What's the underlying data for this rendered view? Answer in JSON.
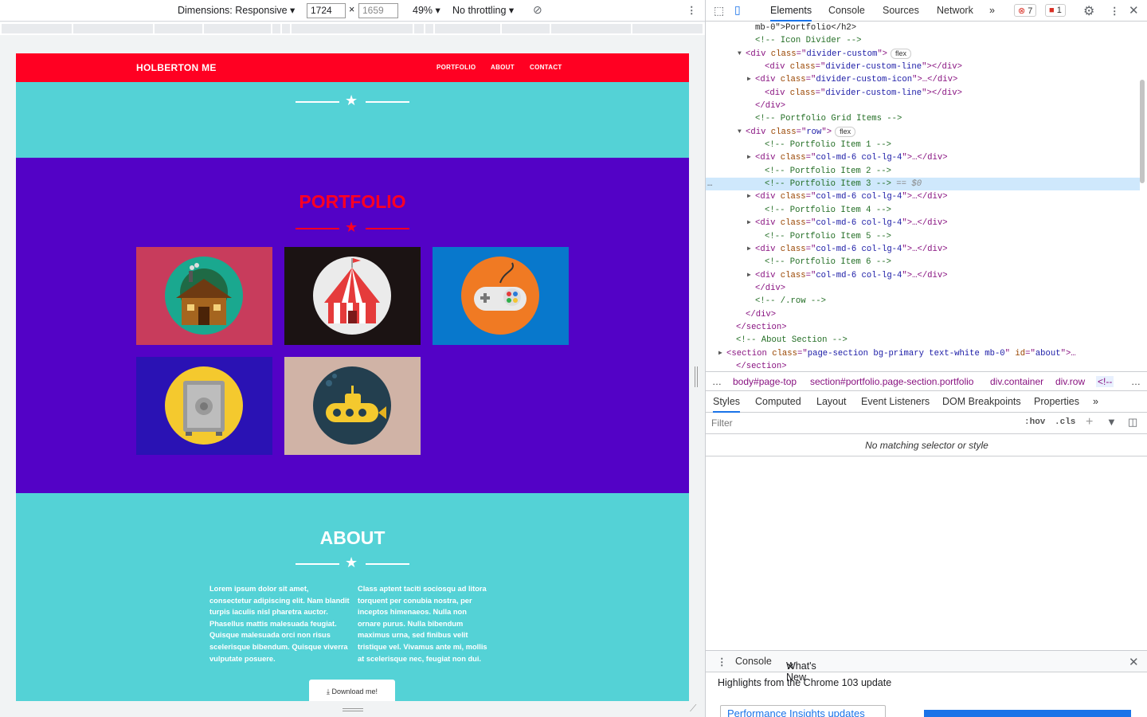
{
  "devbar": {
    "dimensions_label": "Dimensions: Responsive",
    "width": "1724",
    "x": "×",
    "height_placeholder": "1659",
    "zoom": "49%",
    "throttle": "No throttling"
  },
  "site": {
    "brand": "HOLBERTON ME",
    "nav": [
      "PORTFOLIO",
      "ABOUT",
      "CONTACT"
    ],
    "portfolio_title": "PORTFOLIO",
    "about_title": "ABOUT",
    "about_col1": "Lorem ipsum dolor sit amet, consectetur adipiscing elit. Nam blandit turpis iaculis nisl pharetra auctor. Phasellus mattis malesuada feugiat. Quisque malesuada orci non risus scelerisque bibendum. Quisque viverra vulputate posuere.",
    "about_col2": "Class aptent taciti sociosqu ad litora torquent per conubia nostra, per inceptos himenaeos. Nulla non ornare purus. Nulla bibendum maximus urna, sed finibus velit tristique vel. Vivamus ante mi, mollis at scelerisque nec, feugiat non dui.",
    "download": "Download me!",
    "colors": {
      "nav": "#ff0022",
      "teal": "#54d2d6",
      "purple": "#5302c6"
    },
    "tiles": [
      {
        "icon": "cabin-icon",
        "bg": "#c83c5c"
      },
      {
        "icon": "circus-tent-icon",
        "bg": "#1b1313"
      },
      {
        "icon": "game-controller-icon",
        "bg": "#0878cc"
      },
      {
        "icon": "safe-icon",
        "bg": "#2a12b4"
      },
      {
        "icon": "submarine-icon",
        "bg": "#d0b3a6"
      }
    ]
  },
  "devtools": {
    "tabs": [
      "Elements",
      "Console",
      "Sources",
      "Network",
      "»"
    ],
    "errors": "7",
    "warnings": "1",
    "code_lines": [
      {
        "indent": 5,
        "parts": [
          [
            "tx",
            "mb-0\">Portfolio</h2>"
          ]
        ]
      },
      {
        "indent": 5,
        "parts": [
          [
            "cm",
            "<!-- Icon Divider -->"
          ]
        ]
      },
      {
        "indent": 4,
        "arrow": "▼",
        "parts": [
          [
            "tg",
            "<div "
          ],
          [
            "an",
            "class"
          ],
          [
            "tg",
            "=\""
          ],
          [
            "av",
            "divider-custom"
          ],
          [
            "tg",
            "\">"
          ]
        ],
        "pill": "flex"
      },
      {
        "indent": 6,
        "parts": [
          [
            "tg",
            "<div "
          ],
          [
            "an",
            "class"
          ],
          [
            "tg",
            "=\""
          ],
          [
            "av",
            "divider-custom-line"
          ],
          [
            "tg",
            "\"></div>"
          ]
        ]
      },
      {
        "indent": 5,
        "arrow": "▶",
        "parts": [
          [
            "tg",
            "<div "
          ],
          [
            "an",
            "class"
          ],
          [
            "tg",
            "=\""
          ],
          [
            "av",
            "divider-custom-icon"
          ],
          [
            "tg",
            "\">…</div>"
          ]
        ]
      },
      {
        "indent": 6,
        "parts": [
          [
            "tg",
            "<div "
          ],
          [
            "an",
            "class"
          ],
          [
            "tg",
            "=\""
          ],
          [
            "av",
            "divider-custom-line"
          ],
          [
            "tg",
            "\"></div>"
          ]
        ]
      },
      {
        "indent": 5,
        "parts": [
          [
            "tg",
            "</div>"
          ]
        ]
      },
      {
        "indent": 5,
        "parts": [
          [
            "cm",
            "<!-- Portfolio Grid Items -->"
          ]
        ]
      },
      {
        "indent": 4,
        "arrow": "▼",
        "parts": [
          [
            "tg",
            "<div "
          ],
          [
            "an",
            "class"
          ],
          [
            "tg",
            "=\""
          ],
          [
            "av",
            "row"
          ],
          [
            "tg",
            "\">"
          ]
        ],
        "pill": "flex"
      },
      {
        "indent": 6,
        "parts": [
          [
            "cm",
            "<!-- Portfolio Item 1 -->"
          ]
        ]
      },
      {
        "indent": 5,
        "arrow": "▶",
        "parts": [
          [
            "tg",
            "<div "
          ],
          [
            "an",
            "class"
          ],
          [
            "tg",
            "=\""
          ],
          [
            "av",
            "col-md-6 col-lg-4"
          ],
          [
            "tg",
            "\">…</div>"
          ]
        ]
      },
      {
        "indent": 6,
        "parts": [
          [
            "cm",
            "<!-- Portfolio Item 2 -->"
          ]
        ]
      },
      {
        "indent": 6,
        "sel": true,
        "parts": [
          [
            "cm",
            "<!-- Portfolio Item 3 -->"
          ],
          [
            "tx",
            " == $0"
          ]
        ]
      },
      {
        "indent": 5,
        "arrow": "▶",
        "parts": [
          [
            "tg",
            "<div "
          ],
          [
            "an",
            "class"
          ],
          [
            "tg",
            "=\""
          ],
          [
            "av",
            "col-md-6 col-lg-4"
          ],
          [
            "tg",
            "\">…</div>"
          ]
        ]
      },
      {
        "indent": 6,
        "parts": [
          [
            "cm",
            "<!-- Portfolio Item 4 -->"
          ]
        ]
      },
      {
        "indent": 5,
        "arrow": "▶",
        "parts": [
          [
            "tg",
            "<div "
          ],
          [
            "an",
            "class"
          ],
          [
            "tg",
            "=\""
          ],
          [
            "av",
            "col-md-6 col-lg-4"
          ],
          [
            "tg",
            "\">…</div>"
          ]
        ]
      },
      {
        "indent": 6,
        "parts": [
          [
            "cm",
            "<!-- Portfolio Item 5 -->"
          ]
        ]
      },
      {
        "indent": 5,
        "arrow": "▶",
        "parts": [
          [
            "tg",
            "<div "
          ],
          [
            "an",
            "class"
          ],
          [
            "tg",
            "=\""
          ],
          [
            "av",
            "col-md-6 col-lg-4"
          ],
          [
            "tg",
            "\">…</div>"
          ]
        ]
      },
      {
        "indent": 6,
        "parts": [
          [
            "cm",
            "<!-- Portfolio Item 6 -->"
          ]
        ]
      },
      {
        "indent": 5,
        "arrow": "▶",
        "parts": [
          [
            "tg",
            "<div "
          ],
          [
            "an",
            "class"
          ],
          [
            "tg",
            "=\""
          ],
          [
            "av",
            "col-md-6 col-lg-4"
          ],
          [
            "tg",
            "\">…</div>"
          ]
        ]
      },
      {
        "indent": 5,
        "parts": [
          [
            "tg",
            "</div>"
          ]
        ]
      },
      {
        "indent": 5,
        "parts": [
          [
            "cm",
            "<!-- /.row -->"
          ]
        ]
      },
      {
        "indent": 4,
        "parts": [
          [
            "tg",
            "</div>"
          ]
        ]
      },
      {
        "indent": 3,
        "parts": [
          [
            "tg",
            "</section>"
          ]
        ]
      },
      {
        "indent": 3,
        "parts": [
          [
            "cm",
            "<!-- About Section -->"
          ]
        ]
      },
      {
        "indent": 2,
        "arrow": "▶",
        "parts": [
          [
            "tg",
            "<section "
          ],
          [
            "an",
            "class"
          ],
          [
            "tg",
            "=\""
          ],
          [
            "av",
            "page-section bg-primary text-white mb-0"
          ],
          [
            "tg",
            "\" "
          ],
          [
            "an",
            "id"
          ],
          [
            "tg",
            "=\""
          ],
          [
            "av",
            "about"
          ],
          [
            "tg",
            "\">…"
          ]
        ]
      },
      {
        "indent": 3,
        "parts": [
          [
            "tg",
            "</section>"
          ]
        ]
      }
    ],
    "breadcrumbs": [
      "…",
      "body#page-top",
      "section#portfolio.page-section.portfolio",
      "div.container",
      "div.row",
      "<!--",
      "…"
    ],
    "style_tabs": [
      "Styles",
      "Computed",
      "Layout",
      "Event Listeners",
      "DOM Breakpoints",
      "Properties",
      "»"
    ],
    "filter_placeholder": "Filter",
    "hov": ":hov",
    "cls": ".cls",
    "no_match": "No matching selector or style",
    "drawer_tabs": [
      "Console",
      "What's New"
    ],
    "whats_new": "Highlights from the Chrome 103 update",
    "card_title": "Performance Insights updates"
  }
}
